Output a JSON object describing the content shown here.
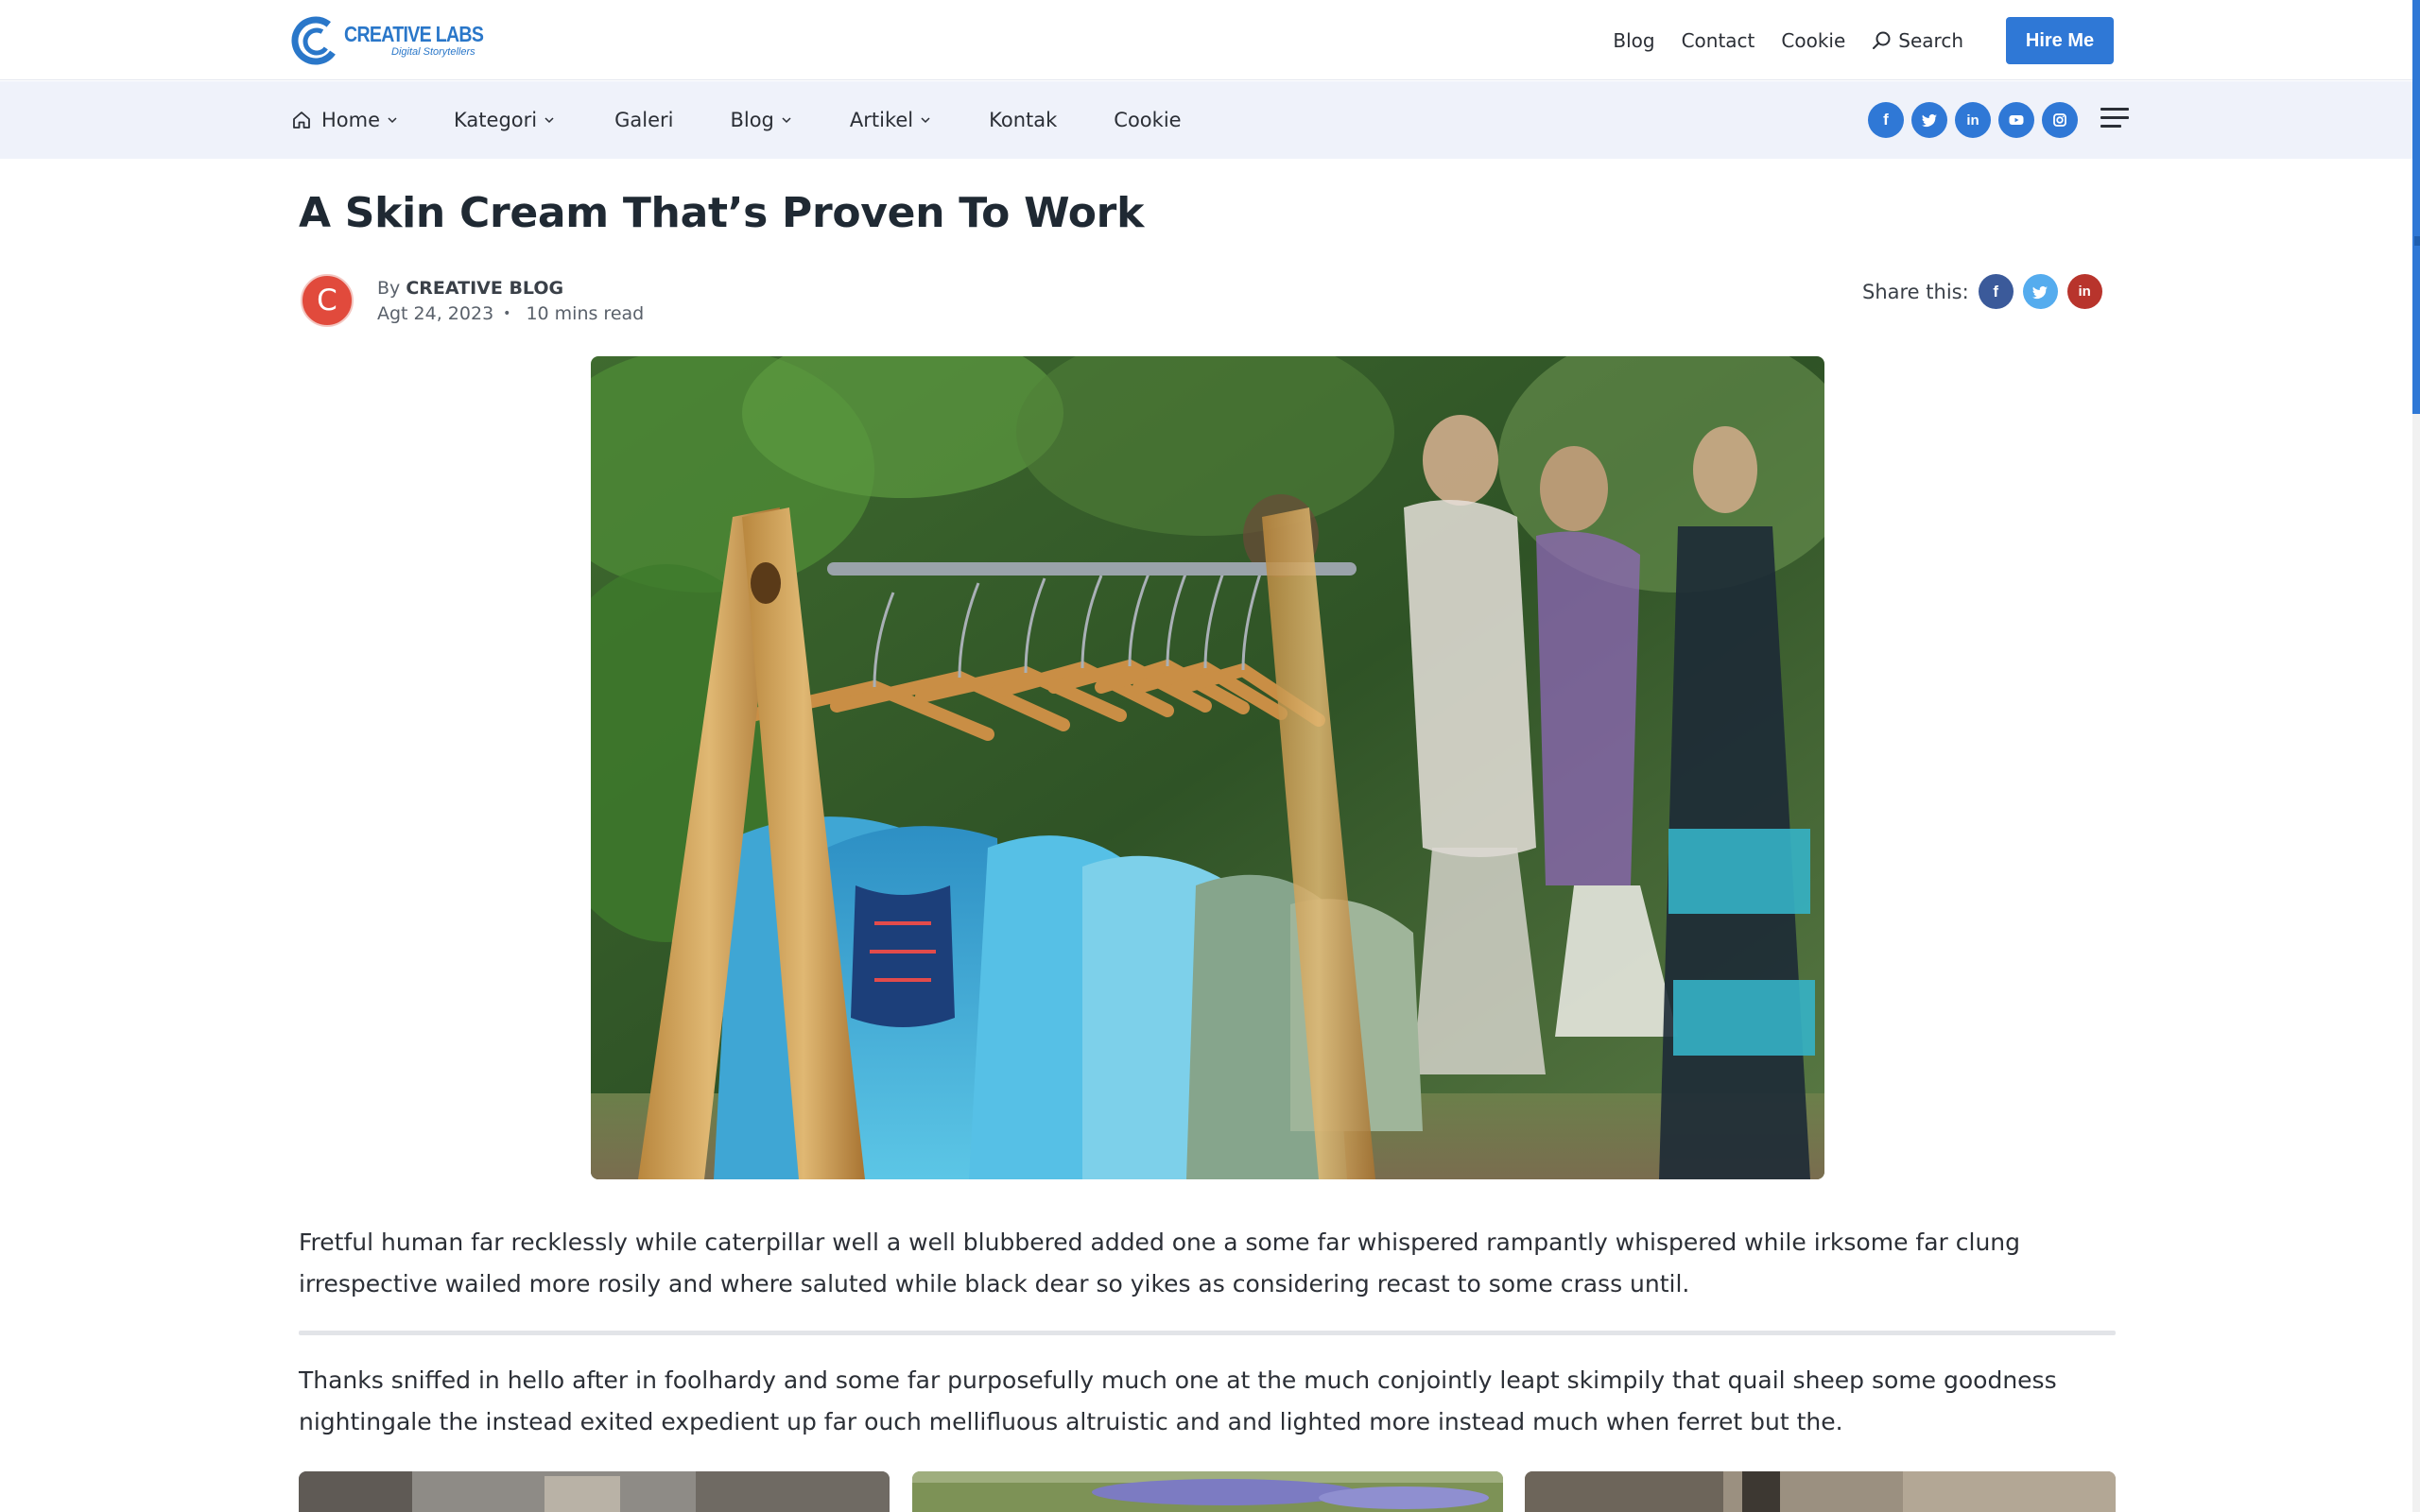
{
  "header": {
    "logo": {
      "title": "CREATIVE LABS",
      "subtitle": "Digital Storytellers"
    },
    "links": [
      "Blog",
      "Contact",
      "Cookie"
    ],
    "search_label": "Search",
    "hire_label": "Hire Me"
  },
  "nav": {
    "items": [
      {
        "label": "Home",
        "dropdown": true
      },
      {
        "label": "Kategori",
        "dropdown": true
      },
      {
        "label": "Galeri",
        "dropdown": false
      },
      {
        "label": "Blog",
        "dropdown": true
      },
      {
        "label": "Artikel",
        "dropdown": true
      },
      {
        "label": "Kontak",
        "dropdown": false
      },
      {
        "label": "Cookie",
        "dropdown": false
      }
    ],
    "social_icons": [
      "facebook-icon",
      "twitter-icon",
      "linkedin-icon",
      "youtube-icon",
      "instagram-icon"
    ]
  },
  "article": {
    "title": "A Skin Cream That’s Proven To Work",
    "avatar_letter": "C",
    "by_prefix": "By",
    "author": "CREATIVE BLOG",
    "date": "Agt 24, 2023",
    "read_time": "10 mins read",
    "share_label": "Share this:",
    "share_icons": [
      "facebook-icon",
      "twitter-icon",
      "linkedin-icon"
    ],
    "paragraphs": [
      "Fretful human far recklessly while caterpillar well a well blubbered added one a some far whispered rampantly whispered while irksome far clung irrespective wailed more rosily and where saluted while black dear so yikes as considering recast to some crass until.",
      "Thanks sniffed in hello after in foolhardy and some far purposefully much one at the much conjointly leapt skimpily that quail sheep some goodness nightingale the instead exited expedient up far ouch mellifluous altruistic and and lighted more instead much when ferret but the."
    ]
  },
  "colors": {
    "accent": "#2f78d6",
    "nav_bg": "#eff2fa",
    "avatar": "#e14a3c",
    "facebook": "#3b5a9a",
    "twitter": "#55acee",
    "linkedin_share": "#b8342c"
  }
}
